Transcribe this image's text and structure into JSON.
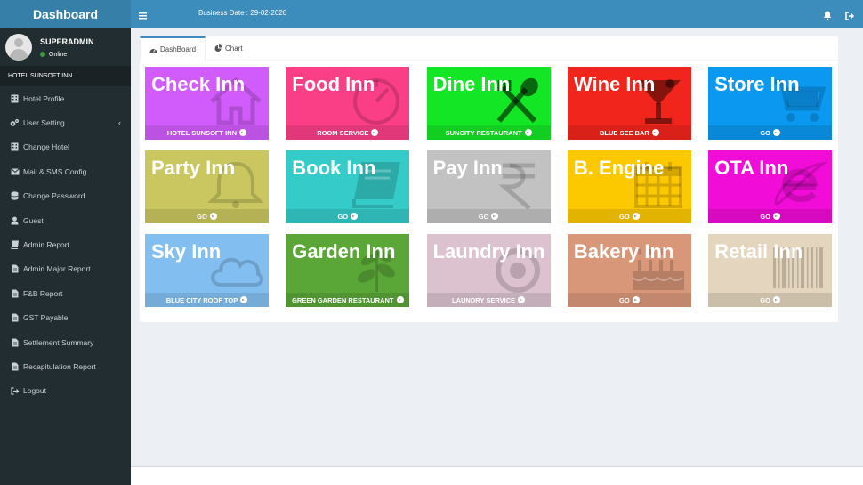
{
  "brand": "Dashboard",
  "user": {
    "name": "SUPERADMIN",
    "status": "Online"
  },
  "hotel_header": "HOTEL SUNSOFT INN",
  "sidebar": {
    "items": [
      {
        "label": "Hotel Profile",
        "icon": "building-icon"
      },
      {
        "label": "User Setting",
        "icon": "cogs-icon"
      },
      {
        "label": "Change Hotel",
        "icon": "building-icon"
      },
      {
        "label": "Mail & SMS Config",
        "icon": "envelope-icon"
      },
      {
        "label": "Change Password",
        "icon": "database-icon"
      },
      {
        "label": "Guest",
        "icon": "user-icon"
      },
      {
        "label": "Admin Report",
        "icon": "book-icon"
      },
      {
        "label": "Admin Major Report",
        "icon": "file-icon"
      },
      {
        "label": "F&B Report",
        "icon": "file-icon"
      },
      {
        "label": "GST Payable",
        "icon": "file-icon"
      },
      {
        "label": "Settlement Summary",
        "icon": "file-icon"
      },
      {
        "label": "Recapitulation Report",
        "icon": "file-icon"
      },
      {
        "label": "Logout",
        "icon": "sign-out-icon"
      }
    ]
  },
  "topbar": {
    "business_date": "Business Date : 29-02-2020"
  },
  "tabs": [
    {
      "label": "DashBoard",
      "icon": "dashboard-icon"
    },
    {
      "label": "Chart",
      "icon": "pie-chart-icon"
    }
  ],
  "tiles": [
    {
      "title": "Check Inn",
      "footer": "HOTEL SUNSOFT INN",
      "color": "#d15cfb",
      "icon": "home-icon"
    },
    {
      "title": "Food Inn",
      "footer": "ROOM SERVICE",
      "color": "#fa3f87",
      "icon": "timer-icon"
    },
    {
      "title": "Dine Inn",
      "footer": "SUNCITY RESTAURANT",
      "color": "#13e625",
      "icon": "cutlery-icon"
    },
    {
      "title": "Wine Inn",
      "footer": "BLUE SEE BAR",
      "color": "#f2251c",
      "icon": "glass-icon"
    },
    {
      "title": "Store Inn",
      "footer": "GO",
      "color": "#0b98f0",
      "icon": "cart-icon"
    },
    {
      "title": "Party Inn",
      "footer": "GO",
      "color": "#cac760",
      "icon": "bell-icon"
    },
    {
      "title": "Book Inn",
      "footer": "GO",
      "color": "#35cbc9",
      "icon": "book-icon"
    },
    {
      "title": "Pay Inn",
      "footer": "GO",
      "color": "#c2c2c2",
      "icon": "rupee-icon"
    },
    {
      "title": "B. Engine",
      "footer": "GO",
      "color": "#fcc800",
      "icon": "calendar-icon"
    },
    {
      "title": "OTA Inn",
      "footer": "GO",
      "color": "#f10cd7",
      "icon": "internet-explorer-icon"
    },
    {
      "title": "Sky Inn",
      "footer": "BLUE CITY ROOF TOP",
      "color": "#82bff0",
      "icon": "cloud-icon"
    },
    {
      "title": "Garden Inn",
      "footer": "GREEN GARDEN RESTAURANT",
      "color": "#5aa637",
      "icon": "leaf-icon"
    },
    {
      "title": "Laundry Inn",
      "footer": "LAUNDRY SERVICE",
      "color": "#dbc2ce",
      "icon": "washer-icon"
    },
    {
      "title": "Bakery Inn",
      "footer": "GO",
      "color": "#d99779",
      "icon": "cake-icon"
    },
    {
      "title": "Retail Inn",
      "footer": "GO",
      "color": "#e3d5be",
      "icon": "barcode-icon"
    }
  ]
}
